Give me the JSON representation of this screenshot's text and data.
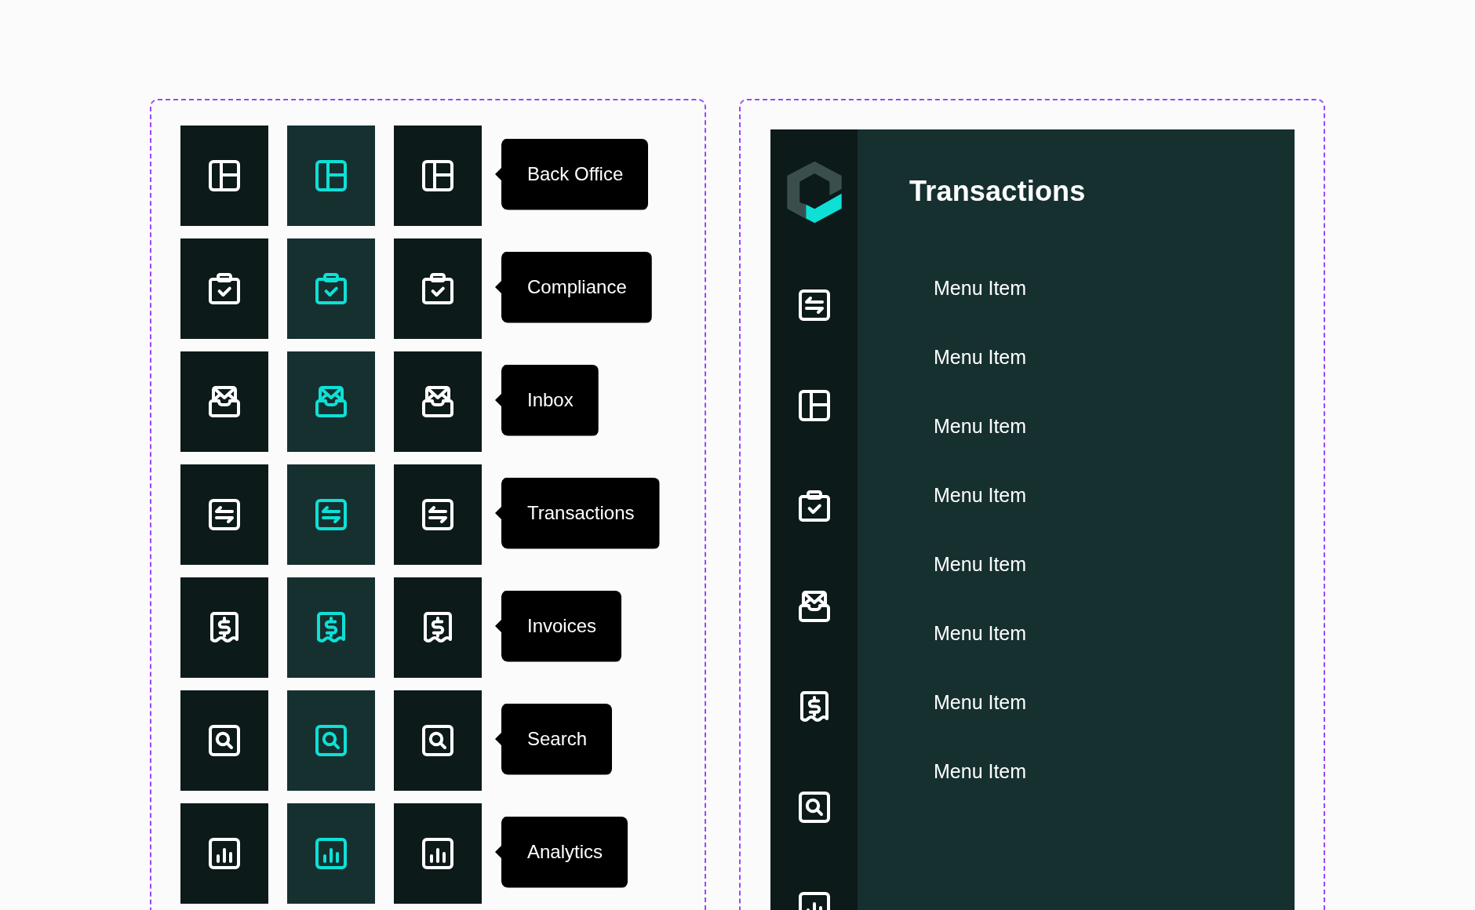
{
  "icon_states": {
    "rows": [
      {
        "kind": "layout",
        "tooltip": "Back Office",
        "variants": [
          {
            "selected": false,
            "hovered": false
          },
          {
            "selected": true,
            "hovered": false
          },
          {
            "selected": false,
            "hovered": true
          }
        ]
      },
      {
        "kind": "clipboard",
        "tooltip": "Compliance",
        "variants": [
          {
            "selected": false,
            "hovered": false
          },
          {
            "selected": true,
            "hovered": false
          },
          {
            "selected": false,
            "hovered": true
          }
        ]
      },
      {
        "kind": "inbox",
        "tooltip": "Inbox",
        "variants": [
          {
            "selected": false,
            "hovered": false
          },
          {
            "selected": true,
            "hovered": false
          },
          {
            "selected": false,
            "hovered": true
          }
        ]
      },
      {
        "kind": "transfer",
        "tooltip": "Transactions",
        "variants": [
          {
            "selected": false,
            "hovered": false
          },
          {
            "selected": true,
            "hovered": false
          },
          {
            "selected": false,
            "hovered": true
          }
        ]
      },
      {
        "kind": "invoice",
        "tooltip": "Invoices",
        "variants": [
          {
            "selected": false,
            "hovered": false
          },
          {
            "selected": true,
            "hovered": false
          },
          {
            "selected": false,
            "hovered": true
          }
        ]
      },
      {
        "kind": "search",
        "tooltip": "Search",
        "variants": [
          {
            "selected": false,
            "hovered": false
          },
          {
            "selected": true,
            "hovered": false
          },
          {
            "selected": false,
            "hovered": true
          }
        ]
      },
      {
        "kind": "chart",
        "tooltip": "Analytics",
        "variants": [
          {
            "selected": false,
            "hovered": false
          },
          {
            "selected": true,
            "hovered": false
          },
          {
            "selected": false,
            "hovered": true
          }
        ]
      }
    ]
  },
  "app_sidebar": {
    "rail": [
      {
        "kind": "transfer",
        "selected": false
      },
      {
        "kind": "layout",
        "selected": false
      },
      {
        "kind": "clipboard",
        "selected": false
      },
      {
        "kind": "inbox",
        "selected": false
      },
      {
        "kind": "invoice",
        "selected": false
      },
      {
        "kind": "search",
        "selected": false
      },
      {
        "kind": "chart",
        "selected": false
      }
    ],
    "title": "Transactions",
    "menu_items": [
      {
        "label": "Menu Item",
        "selected": false
      },
      {
        "label": "Menu Item",
        "selected": false
      },
      {
        "label": "Menu Item",
        "selected": false
      },
      {
        "label": "Menu Item",
        "selected": false
      },
      {
        "label": "Menu Item",
        "selected": false
      },
      {
        "label": "Menu Item",
        "selected": false
      },
      {
        "label": "Menu Item",
        "selected": false
      },
      {
        "label": "Menu Item",
        "selected": false
      }
    ]
  }
}
